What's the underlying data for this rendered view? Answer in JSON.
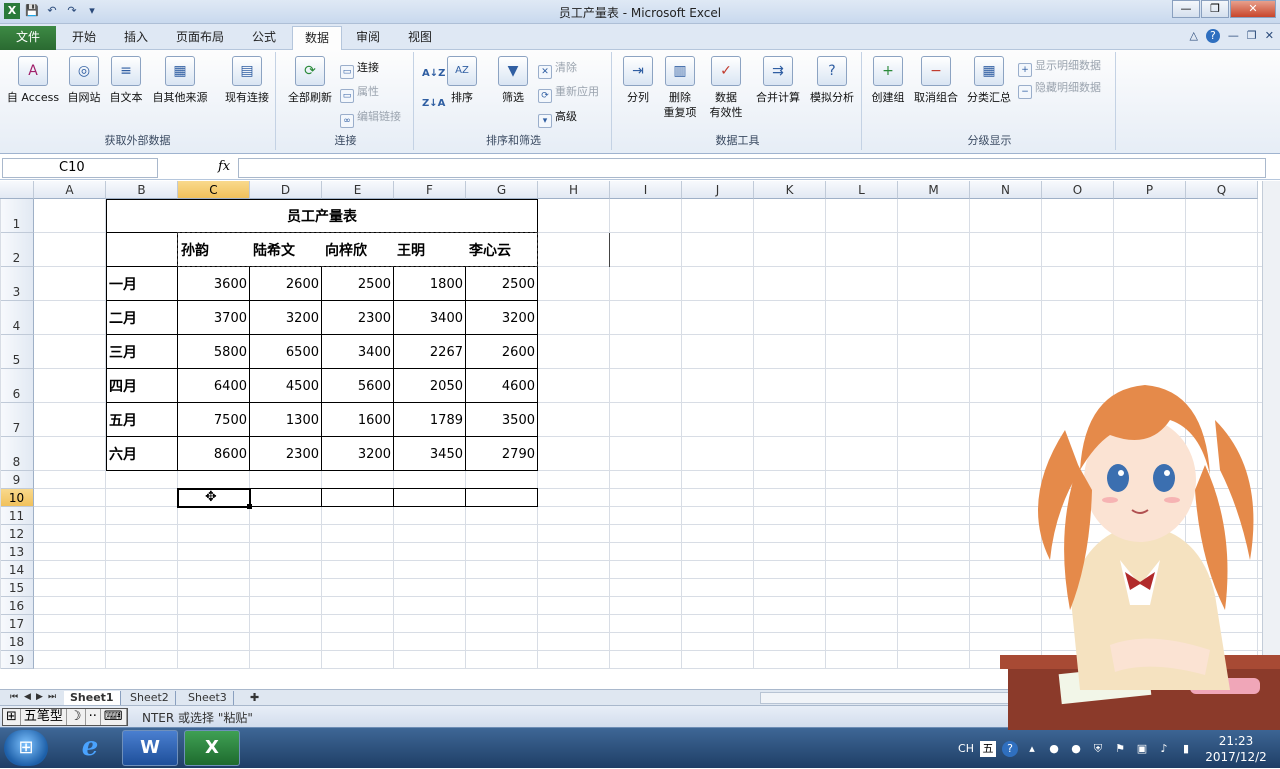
{
  "window": {
    "title": "员工产量表 - Microsoft Excel",
    "min": "—",
    "restore": "❐",
    "close": "✕"
  },
  "qat": {
    "save": "💾",
    "undo": "↶",
    "redo": "↷",
    "more": "▾"
  },
  "tabs": [
    "文件",
    "开始",
    "插入",
    "页面布局",
    "公式",
    "数据",
    "审阅",
    "视图"
  ],
  "active_tab": "数据",
  "tab_right": {
    "caret": "△",
    "help": "?",
    "min": "—",
    "restore": "❐",
    "close": "✕"
  },
  "ribbon": {
    "get_external": {
      "label": "获取外部数据",
      "access": "自 Access",
      "web": "自网站",
      "text": "自文本",
      "other": "自其他来源",
      "existing": "现有连接"
    },
    "connections": {
      "label": "连接",
      "refresh_all": "全部刷新",
      "connections": "连接",
      "properties": "属性",
      "edit_links": "编辑链接"
    },
    "sort_filter": {
      "label": "排序和筛选",
      "sort": "排序",
      "filter": "筛选",
      "clear": "清除",
      "reapply": "重新应用",
      "advanced": "高级"
    },
    "data_tools": {
      "label": "数据工具",
      "text_to_columns": "分列",
      "remove_dup_1": "删除",
      "remove_dup_2": "重复项",
      "validation_1": "数据",
      "validation_2": "有效性",
      "consolidate": "合并计算",
      "what_if": "模拟分析"
    },
    "outline": {
      "label": "分级显示",
      "group": "创建组",
      "ungroup": "取消组合",
      "subtotal": "分类汇总",
      "show_detail": "显示明细数据",
      "hide_detail": "隐藏明细数据"
    }
  },
  "name_box": "C10",
  "fx": "fx",
  "formula": "",
  "columns": [
    "A",
    "B",
    "C",
    "D",
    "E",
    "F",
    "G",
    "H",
    "I",
    "J",
    "K",
    "L",
    "M",
    "N",
    "O",
    "P",
    "Q"
  ],
  "rows": [
    "1",
    "2",
    "3",
    "4",
    "5",
    "6",
    "7",
    "8",
    "9",
    "10",
    "11",
    "12",
    "13",
    "14",
    "15",
    "16",
    "17",
    "18",
    "19"
  ],
  "sheet": {
    "title": "员工产量表",
    "employees": [
      "孙韵",
      "陆希文",
      "向梓欣",
      "王明",
      "李心云"
    ],
    "months": [
      "一月",
      "二月",
      "三月",
      "四月",
      "五月",
      "六月"
    ],
    "values": [
      [
        "3600",
        "2600",
        "2500",
        "1800",
        "2500"
      ],
      [
        "3700",
        "3200",
        "2300",
        "3400",
        "3200"
      ],
      [
        "5800",
        "6500",
        "3400",
        "2267",
        "2600"
      ],
      [
        "6400",
        "4500",
        "5600",
        "2050",
        "4600"
      ],
      [
        "7500",
        "1300",
        "1600",
        "1789",
        "3500"
      ],
      [
        "8600",
        "2300",
        "3200",
        "3450",
        "2790"
      ]
    ]
  },
  "sheet_tabs": [
    "Sheet1",
    "Sheet2",
    "Sheet3"
  ],
  "sheet_nav": {
    "first": "⏮",
    "prev": "◀",
    "next": "▶",
    "last": "⏭"
  },
  "status": {
    "text": "NTER 或选择 \"粘贴\""
  },
  "ime": {
    "logo": "⊞",
    "mode": "五笔型",
    "moon": "☽",
    "dots": "··",
    "kbd": "⌨"
  },
  "taskbar": {
    "start": "⊞",
    "apps": [
      {
        "name": "ie",
        "glyph": "e"
      },
      {
        "name": "word",
        "glyph": "W"
      },
      {
        "name": "excel",
        "glyph": "X"
      }
    ],
    "tray_lang": "CH",
    "tray_ime": "五",
    "tray_help": "?",
    "time": "21:23",
    "date": "2017/12/2"
  },
  "colors": {
    "accent_green": "#2a6a31",
    "selected_header": "#f1c15b"
  }
}
